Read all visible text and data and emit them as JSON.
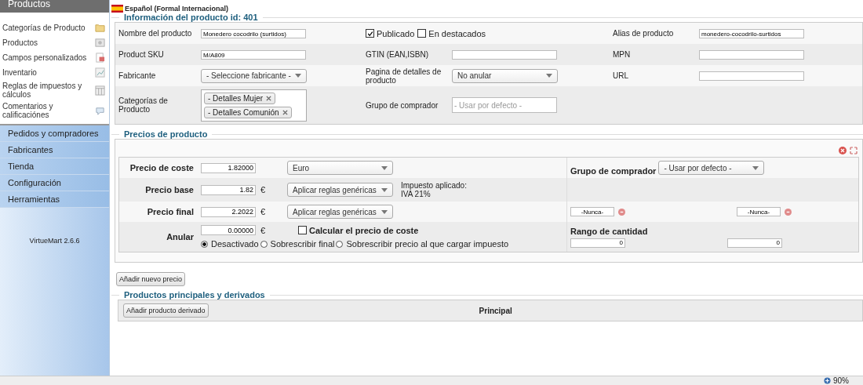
{
  "sidebar": {
    "header": "Productos",
    "items": [
      {
        "label": "Categorías de Producto"
      },
      {
        "label": "Productos"
      },
      {
        "label": "Campos personalizados"
      },
      {
        "label": "Inventario"
      },
      {
        "label": "Reglas de impuestos y cálculos"
      },
      {
        "label": "Comentarios y calificaciónes"
      }
    ],
    "menu": [
      {
        "label": "Pedidos y compradores"
      },
      {
        "label": "Fabricantes"
      },
      {
        "label": "Tienda"
      },
      {
        "label": "Configuración"
      },
      {
        "label": "Herramientas"
      }
    ],
    "version": "VirtueMart 2.6.6"
  },
  "language": "Español (Formal Internacional)",
  "product_info": {
    "title": "Información del producto id: 401",
    "rows": [
      {
        "cells": [
          {
            "kind": "input",
            "label": "Nombre del producto",
            "value": "Monedero cocodrilo (surtidos)"
          },
          {
            "kind": "checks",
            "items": [
              {
                "label": "Publicado",
                "checked": true
              },
              {
                "label": "En destacados",
                "checked": false
              }
            ]
          },
          {
            "kind": "input",
            "label": "Alias de producto",
            "value": "monedero-cocodrilo-surtidos"
          }
        ]
      },
      {
        "cells": [
          {
            "kind": "input",
            "label": "Product SKU",
            "value": "M/A809"
          },
          {
            "kind": "input",
            "label": "GTIN (EAN,ISBN)"
          },
          {
            "kind": "input",
            "label": "MPN"
          }
        ]
      },
      {
        "cells": [
          {
            "kind": "select",
            "label": "Fabricante",
            "value": "- Seleccione fabricante -"
          },
          {
            "kind": "select",
            "label": "Pagina de detalles de producto",
            "value": "No anular"
          },
          {
            "kind": "input",
            "label": "URL"
          }
        ]
      },
      {
        "cells": [
          {
            "kind": "tags",
            "label": "Categorías de Producto",
            "tags": [
              "- Detalles Mujer",
              "- Detalles Comunión"
            ]
          },
          {
            "kind": "placeholder",
            "label": "Grupo de comprador",
            "placeholder": "- Usar por defecto -"
          }
        ]
      }
    ]
  },
  "prices": {
    "title": "Precios de producto",
    "rows": [
      {
        "kind": "price",
        "label": "Precio de coste",
        "value": "1.82000",
        "select": "Euro"
      },
      {
        "kind": "price",
        "label": "Precio base",
        "value": "1.82",
        "currency": "€",
        "select": "Aplicar reglas genéricas",
        "note": [
          "Impuesto aplicado:",
          "IVA 21%"
        ]
      },
      {
        "kind": "price",
        "label": "Precio final",
        "value": "2.2022",
        "currency": "€",
        "select": "Aplicar reglas genéricas"
      },
      {
        "kind": "override",
        "label": "Anular",
        "value": "0.00000",
        "currency": "€",
        "checkbox": {
          "label": "Calcular el precio de coste",
          "checked": false
        },
        "options": [
          {
            "label": "Desactivado",
            "selected": true
          },
          {
            "label": "Sobrescribir final",
            "selected": false
          },
          {
            "label": "Sobrescribir precio al que cargar impuesto",
            "selected": false
          }
        ]
      }
    ],
    "side": {
      "shopper_group": {
        "label": "Grupo de comprador",
        "value": "- Usar por defecto -"
      },
      "dates": [
        "-Nunca-",
        "-Nunca-"
      ],
      "quantity": {
        "label": "Rango de cantidad",
        "values": [
          "0",
          "0"
        ]
      }
    }
  },
  "add_price_button": "Añadir nuevo precio",
  "variants": {
    "title": "Productos principales y derivados",
    "button": "Añadir producto derivado",
    "column": "Principal"
  },
  "status_bar": {
    "zoom": "90%"
  }
}
